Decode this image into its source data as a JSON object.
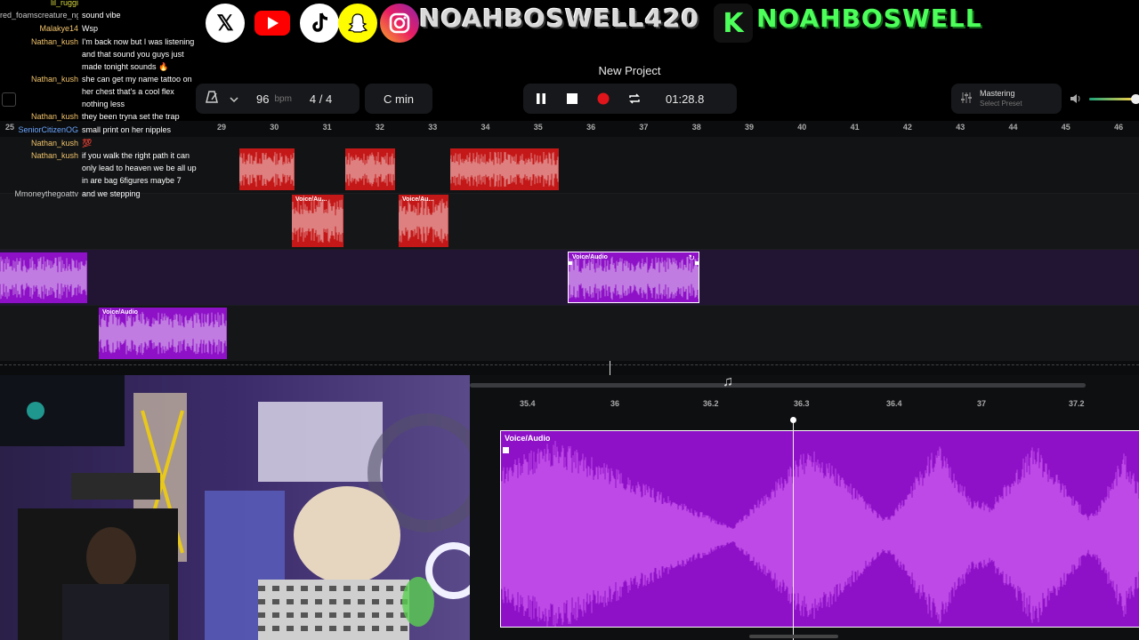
{
  "overlay": {
    "icons": [
      "x-logo",
      "youtube-logo",
      "tiktok-logo",
      "snapchat-logo",
      "instagram-logo",
      "kick-logo"
    ],
    "handle_main": "NOAHBOSWELL420",
    "kick_letter": "K",
    "handle_kick": "NOAHBOSWELL"
  },
  "project": {
    "title": "New Project",
    "bpm": "96",
    "bpm_unit": "bpm",
    "time_signature": "4 / 4",
    "key": "C min",
    "time": "01:28.8",
    "mastering_label": "Mastering",
    "mastering_preset": "Select Preset",
    "volume_level": 0.9
  },
  "ruler": {
    "ticks": [
      "29",
      "30",
      "31",
      "32",
      "33",
      "34",
      "35",
      "36",
      "37",
      "38",
      "39",
      "40",
      "41",
      "42",
      "43",
      "44",
      "45",
      "46"
    ]
  },
  "clips": {
    "voice_label": "Voice/Audio",
    "voice_label_short": "Voice/Au..."
  },
  "editor": {
    "ruler_ticks": [
      "35.4",
      "36",
      "36.2",
      "36.3",
      "36.4",
      "37",
      "37.2"
    ],
    "clip_label": "Voice/Audio"
  },
  "chat": {
    "messages": [
      {
        "user": "lil_ruggi",
        "text": "",
        "color": "#d8d840"
      },
      {
        "user": "red_foamscreature_ngoo",
        "text": "sound vibe",
        "color": "#c8c8c8"
      },
      {
        "user": "Malakye14",
        "text": "Wsp",
        "color": "#f2c46c"
      },
      {
        "user": "Nathan_kush",
        "text": "I'm back now but I was listening and that sound you guys just made tonight sounds 🔥",
        "color": "#f2c46c"
      },
      {
        "user": "Nathan_kush",
        "text": "she can get my name tattoo on her chest that's a cool flex nothing less",
        "color": "#f2c46c"
      },
      {
        "user": "Nathan_kush",
        "text": "they been tryna set the trap",
        "color": "#f2c46c"
      },
      {
        "user": "SeniorCitizenOG",
        "text": "small print on her nipples",
        "color": "#6aa6ff"
      },
      {
        "user": "Nathan_kush",
        "text": "💯",
        "color": "#f2c46c"
      },
      {
        "user": "Nathan_kush",
        "text": "if you walk the right path it can only lead to heaven we be all up in are bag 6figures maybe 7",
        "color": "#f2c46c"
      },
      {
        "user": "Mmoneythegoattv",
        "text": "and we stepping",
        "color": "#c8c8c8"
      }
    ]
  },
  "colors": {
    "red_clip": "#c41818",
    "purple_clip": "#8e11c8",
    "record": "#e0151b"
  }
}
